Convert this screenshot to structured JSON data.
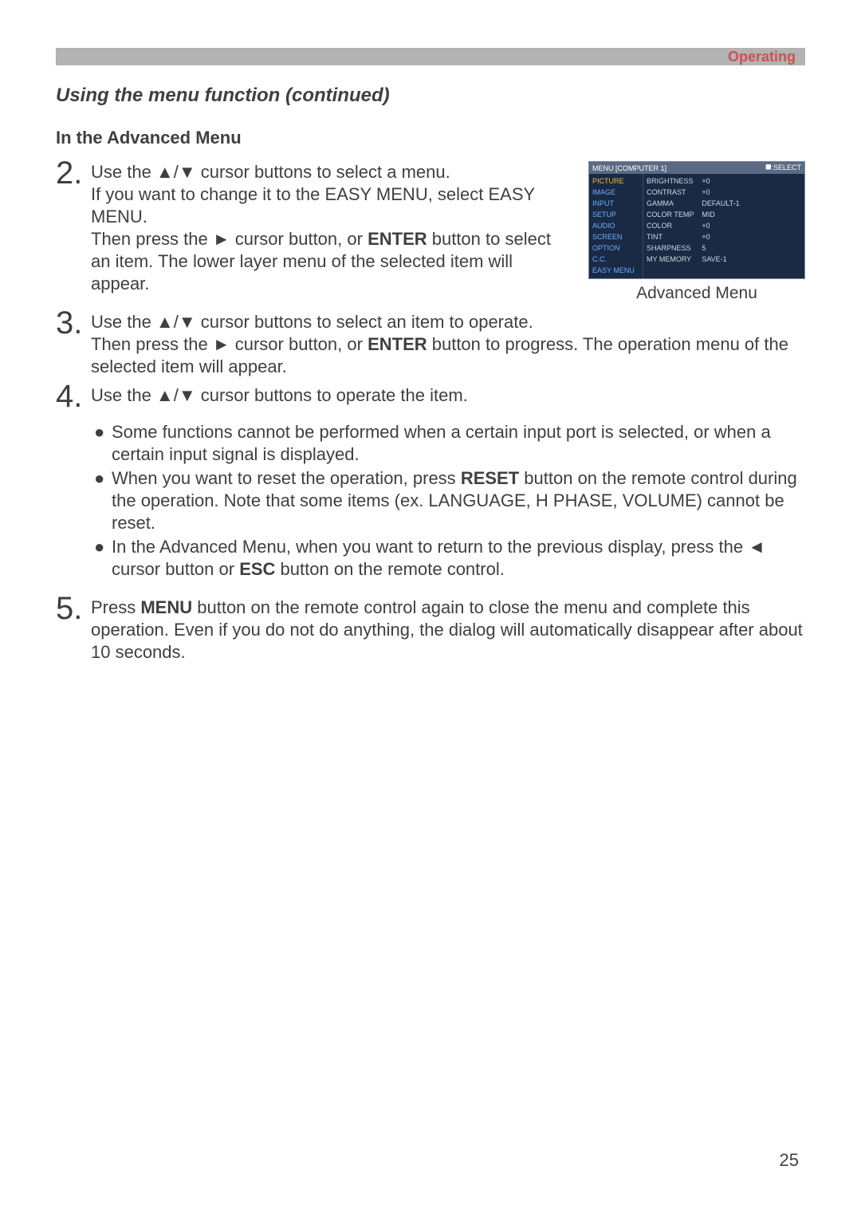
{
  "header": {
    "section": "Operating"
  },
  "title": "Using the menu function (continued)",
  "subtitle": "In the Advanced Menu",
  "steps": {
    "s2": {
      "num": "2.",
      "a": "Use the ▲/▼ cursor buttons to select a menu.",
      "b": "If you want to change it to the EASY MENU, select EASY MENU.",
      "c1": "Then press the ► cursor button, or ",
      "c_bold": "ENTER",
      "c2": " button to select an item. The lower layer menu of the selected item will appear."
    },
    "s3": {
      "num": "3.",
      "a": "Use the ▲/▼ cursor buttons to select an item to operate.",
      "b1": "Then press the ► cursor button, or ",
      "b_bold": "ENTER",
      "b2": " button to progress. The operation menu of the selected item will appear."
    },
    "s4": {
      "num": "4.",
      "a": "Use the ▲/▼ cursor buttons to operate the item."
    },
    "s5": {
      "num": "5.",
      "a1": "Press ",
      "a_bold": "MENU",
      "a2": " button on the remote control again to close the menu and complete this operation. Even if you do not do anything, the dialog will automatically disappear after about 10 seconds."
    }
  },
  "bullets": {
    "b1": "Some functions cannot be performed when a certain input port is selected, or when a certain input signal is displayed.",
    "b2_a": "When you want to reset the operation, press ",
    "b2_bold": "RESET",
    "b2_b": " button on the remote control during the operation. Note that some items (ex. LANGUAGE, H PHASE, VOLUME) cannot be reset.",
    "b3_a": "In the Advanced Menu, when you want to return to the previous display, press the ◄ cursor button or ",
    "b3_bold": "ESC",
    "b3_b": " button on the remote control."
  },
  "figure": {
    "caption": "Advanced Menu"
  },
  "osd": {
    "top_left": "MENU [COMPUTER 1]",
    "top_right": "⯀:SELECT",
    "left": {
      "picture": "PICTURE",
      "image": "IMAGE",
      "input": "INPUT",
      "setup": "SETUP",
      "audio": "AUDIO",
      "screen": "SCREEN",
      "option": "OPTION",
      "cc": "C.C.",
      "easy": "EASY MENU"
    },
    "right": {
      "brightness_l": "BRIGHTNESS",
      "brightness_v": "+0",
      "contrast_l": "CONTRAST",
      "contrast_v": "+0",
      "gamma_l": "GAMMA",
      "gamma_v": "DEFAULT-1",
      "colortemp_l": "COLOR TEMP",
      "colortemp_v": "MID",
      "color_l": "COLOR",
      "color_v": "+0",
      "tint_l": "TINT",
      "tint_v": "+0",
      "sharp_l": "SHARPNESS",
      "sharp_v": "5",
      "mymem_l": "MY MEMORY",
      "mymem_v": "SAVE-1"
    }
  },
  "page_number": "25"
}
